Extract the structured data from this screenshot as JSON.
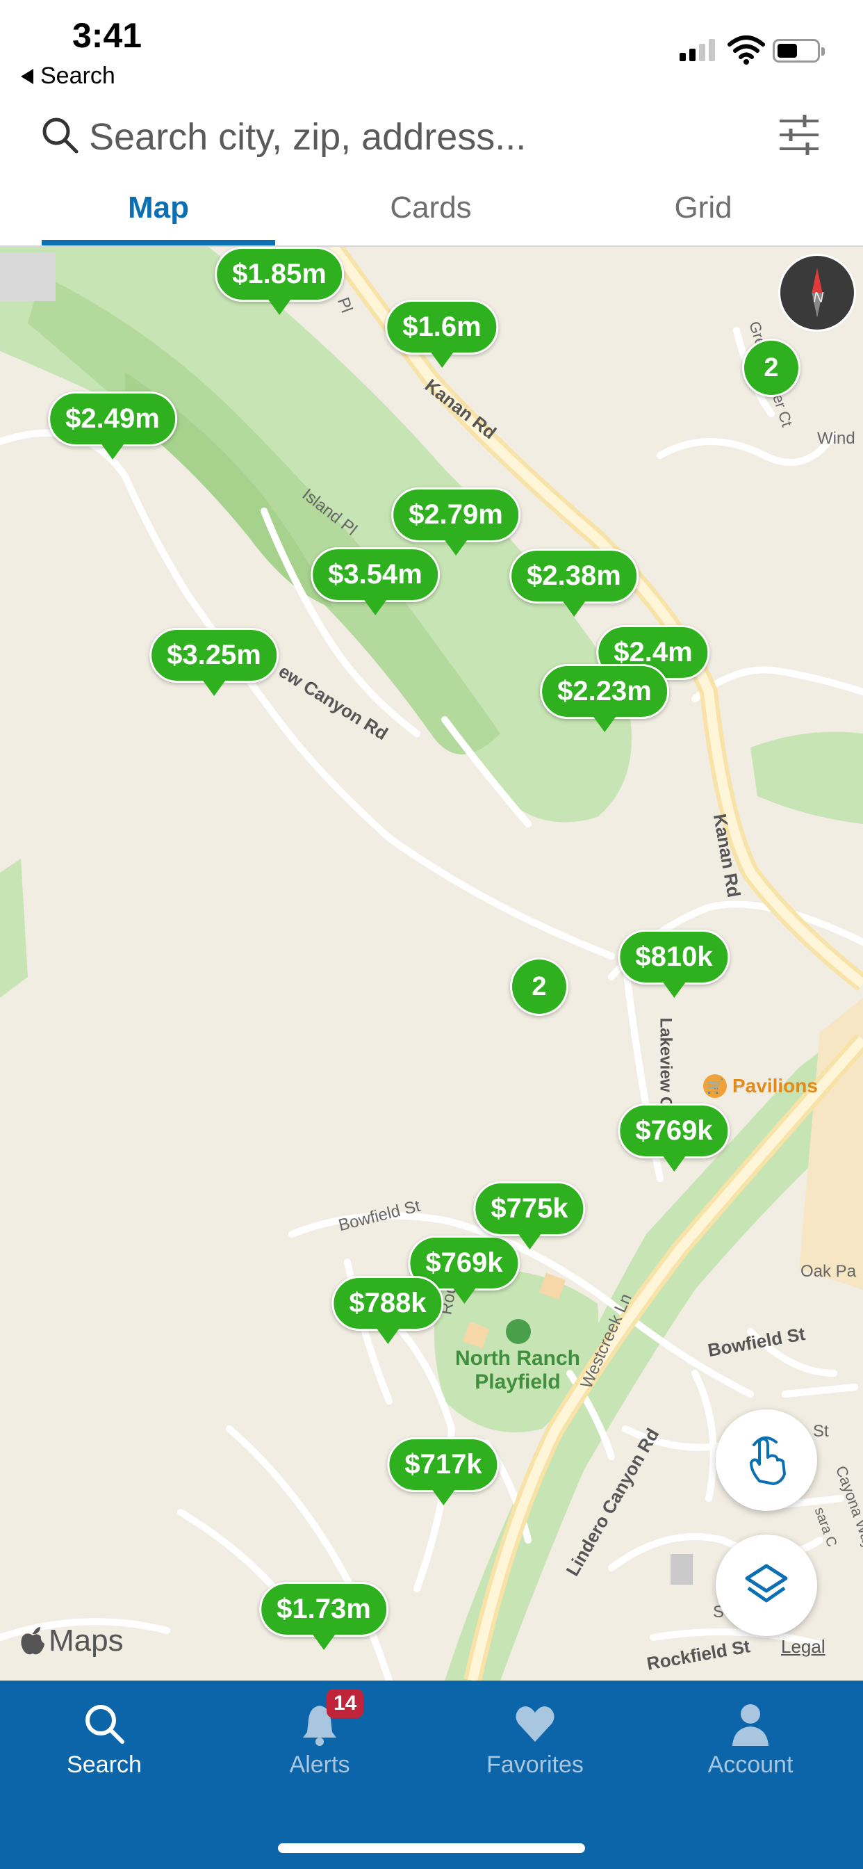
{
  "status_bar": {
    "time": "3:41",
    "back_label": "Search"
  },
  "search": {
    "placeholder": "Search city, zip, address..."
  },
  "tabs": [
    {
      "label": "Map",
      "active": true
    },
    {
      "label": "Cards",
      "active": false
    },
    {
      "label": "Grid",
      "active": false
    }
  ],
  "map": {
    "price_pins": [
      "$1.85m",
      "$1.6m",
      "$2.49m",
      "$2.79m",
      "$3.54m",
      "$2.38m",
      "$2.4m",
      "$2.23m",
      "$3.25m",
      "$810k",
      "$769k",
      "$775k",
      "$769k",
      "$788k",
      "$717k",
      "$1.73m"
    ],
    "clusters": [
      "2",
      "2"
    ],
    "road_labels": [
      "Kanan Rd",
      "Kanan Rd",
      "Island Pl",
      "ew Canyon Rd",
      "Grey Feather Ct",
      "Wind",
      "Lakeview C",
      "Bowfield St",
      "Bowfield St",
      "Oak Pa",
      "Westcreek Ln",
      "Lindero Canyon Rd",
      "Rockfield St",
      "Rod",
      "St",
      "Cayona Way",
      "sara C",
      "S",
      "Pl"
    ],
    "poi": "Pavilions",
    "park": "North Ranch Playfield",
    "attribution": "Maps",
    "legal": "Legal",
    "colors": {
      "pin": "#2fb01e",
      "park": "#c7e4b4"
    }
  },
  "bottom_nav": [
    {
      "label": "Search",
      "icon": "search-icon",
      "active": true
    },
    {
      "label": "Alerts",
      "icon": "bell-icon",
      "badge": "14",
      "active": false
    },
    {
      "label": "Favorites",
      "icon": "heart-icon",
      "active": false
    },
    {
      "label": "Account",
      "icon": "person-icon",
      "active": false
    }
  ],
  "theme": {
    "accent": "#0b6fb3",
    "nav_bg": "#0b65a8"
  }
}
